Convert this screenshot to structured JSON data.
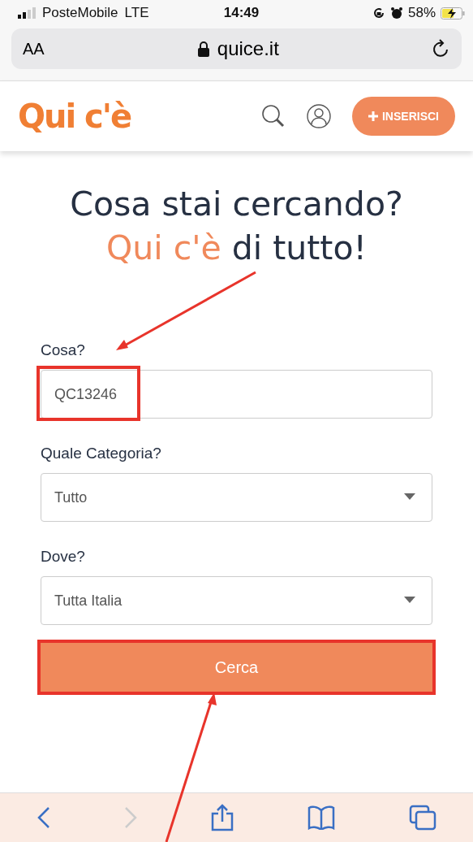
{
  "status_bar": {
    "carrier": "PosteMobile",
    "network": "LTE",
    "time": "14:49",
    "battery": "58%",
    "charging": true
  },
  "address_bar": {
    "text_size": "AA",
    "url": "quice.it",
    "secure": true
  },
  "header": {
    "logo": "Qui c'è",
    "insert_button": "INSERISCI"
  },
  "headline": [
    {
      "text": "Cosa stai cercando?",
      "accent": false
    },
    {
      "text": "Qui c'è",
      "accent": true
    },
    {
      "text": "di tutto!",
      "accent": false
    }
  ],
  "form": {
    "fields": [
      {
        "kind": "text",
        "label": "Cosa?",
        "value": "QC13246",
        "highlighted": true
      },
      {
        "kind": "select",
        "label": "Quale Categoria?",
        "value": "Tutto",
        "highlighted": false
      },
      {
        "kind": "select",
        "label": "Dove?",
        "value": "Tutta Italia",
        "highlighted": false
      }
    ],
    "submit": {
      "label": "Cerca",
      "highlighted": true
    }
  },
  "toolbar": {
    "back_disabled": false,
    "forward_disabled": true
  }
}
